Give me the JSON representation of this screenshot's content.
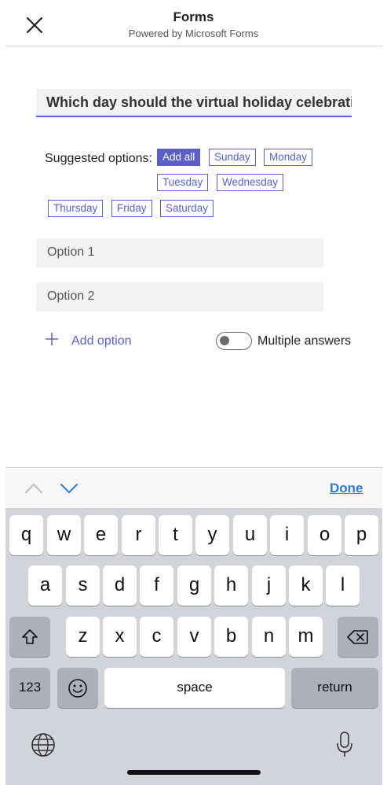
{
  "header": {
    "title": "Forms",
    "subtitle": "Powered by Microsoft Forms",
    "close_icon": "close-icon"
  },
  "question": {
    "value": "Which day should the virtual holiday celebration be held?"
  },
  "suggested": {
    "label": "Suggested options:",
    "add_all": "Add all",
    "options": [
      "Sunday",
      "Monday",
      "Tuesday",
      "Wednesday",
      "Thursday",
      "Friday",
      "Saturday"
    ]
  },
  "options": {
    "placeholders": [
      "Option 1",
      "Option 2"
    ]
  },
  "add_option": {
    "label": "Add option",
    "icon": "plus-icon"
  },
  "multiple_answers": {
    "label": "Multiple answers",
    "enabled": false
  },
  "accessory_bar": {
    "prev_icon": "chevron-up-icon",
    "next_icon": "chevron-down-icon",
    "done_label": "Done"
  },
  "keyboard": {
    "row1": [
      "q",
      "w",
      "e",
      "r",
      "t",
      "y",
      "u",
      "i",
      "o",
      "p"
    ],
    "row2": [
      "a",
      "s",
      "d",
      "f",
      "g",
      "h",
      "j",
      "k",
      "l"
    ],
    "row3": [
      "z",
      "x",
      "c",
      "v",
      "b",
      "n",
      "m"
    ],
    "numbers_label": "123",
    "space_label": "space",
    "return_label": "return",
    "icons": [
      "shift-icon",
      "backspace-icon",
      "emoji-icon",
      "globe-icon",
      "microphone-icon"
    ]
  },
  "colors": {
    "accent": "#5b5fc7",
    "link_blue": "#2f7bd6",
    "field_bg": "#f3f2f1",
    "keyboard_bg": "#d1d4db"
  }
}
